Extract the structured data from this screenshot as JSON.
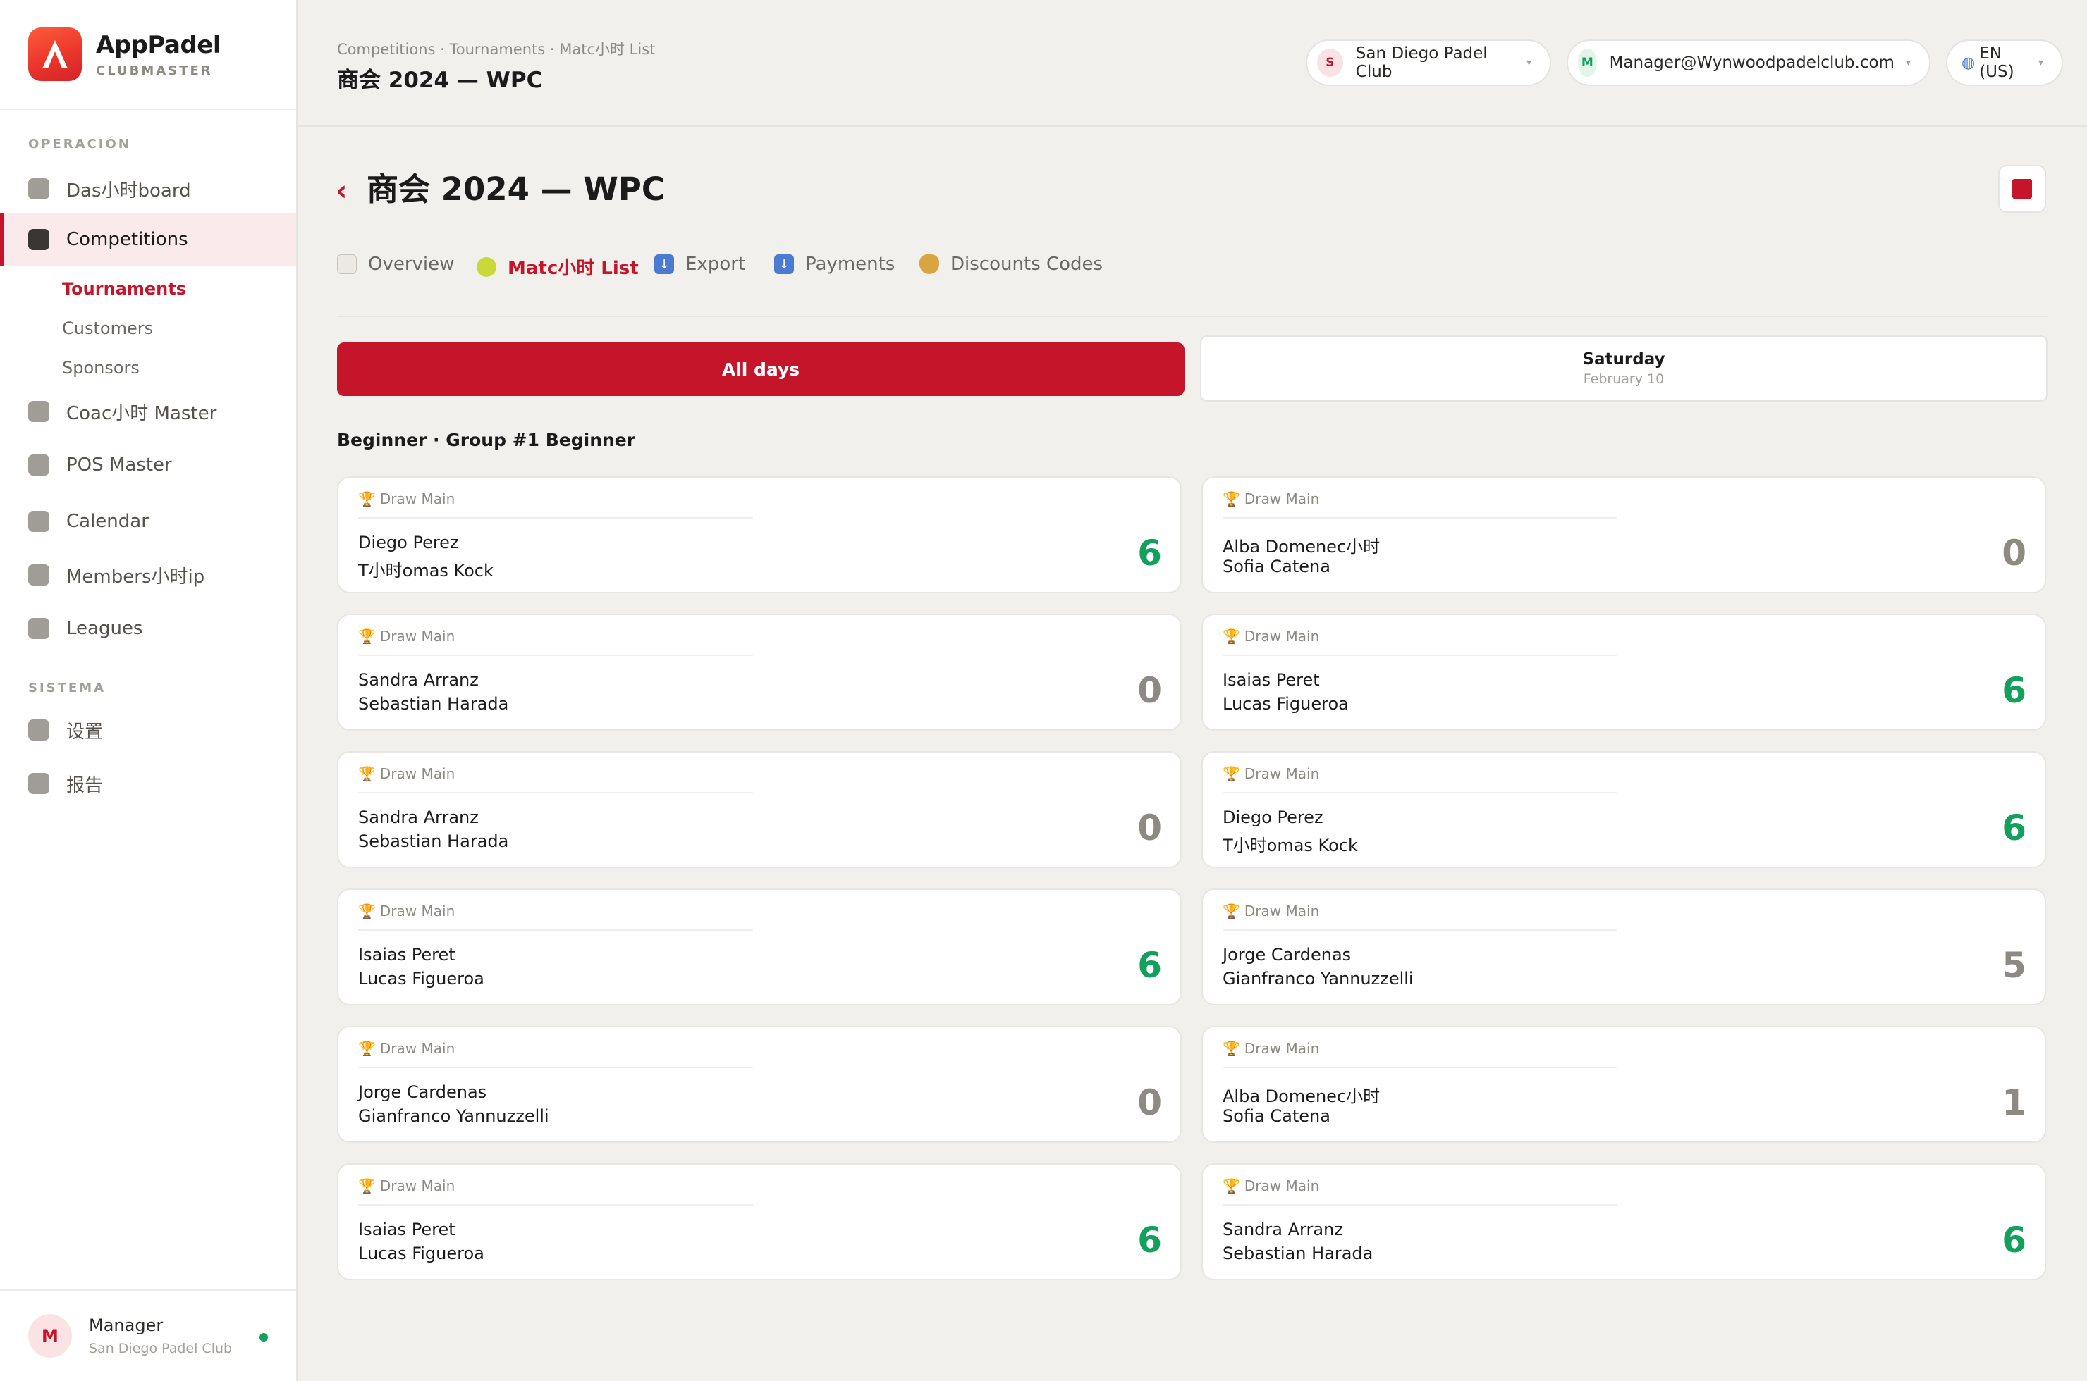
{
  "brand": {
    "name": "AppPadel",
    "sub": "CLUBMASTER"
  },
  "sidebar": {
    "section_operacion": "OPERACIÓN",
    "section_sistema": "SISTEMA",
    "items": [
      {
        "label": "Das小时board"
      },
      {
        "label": "Competitions"
      },
      {
        "label": "Coac小时 Master"
      },
      {
        "label": "POS Master"
      },
      {
        "label": "Calendar"
      },
      {
        "label": "Members小时ip"
      },
      {
        "label": "Leagues"
      },
      {
        "label": "设置"
      },
      {
        "label": "报告"
      }
    ],
    "subitems": [
      {
        "label": "Tournaments"
      },
      {
        "label": "Customers"
      },
      {
        "label": "Sponsors"
      }
    ]
  },
  "profile": {
    "initial": "M",
    "name": "Manager",
    "club": "San Diego Padel Club"
  },
  "header": {
    "breadcrumb": "Competitions · Tournaments · Matc小时 List",
    "title": "商会 2024 — WPC",
    "club": {
      "initial": "S",
      "label": "San Diego Padel Club"
    },
    "user": {
      "initial": "M",
      "label": "Manager@Wynwoodpadelclub.com"
    },
    "lang": {
      "label": "EN (US)"
    }
  },
  "main": {
    "title": "商会 2024 — WPC",
    "tabs": [
      {
        "label": "Overview",
        "icon": "calendar-icon"
      },
      {
        "label": "Matc小时 List",
        "icon": "tennis-ball-icon"
      },
      {
        "label": "Export",
        "icon": "download-icon"
      },
      {
        "label": "Payments",
        "icon": "download-icon"
      },
      {
        "label": "Discounts Codes",
        "icon": "money-bag-icon"
      }
    ],
    "days": {
      "all": "All days",
      "saturday": {
        "day": "Saturday",
        "date": "February 10"
      }
    },
    "group_title": "Beginner · Group #1 Beginner",
    "draw_label": "Draw Main",
    "matches": [
      {
        "p1": "Diego Perez",
        "p2": "T小时omas Kock",
        "score": "6",
        "win": true
      },
      {
        "p1": "Alba Domenec小时",
        "p2": "Sofia Catena",
        "score": "0",
        "win": false
      },
      {
        "p1": "Sandra Arranz",
        "p2": "Sebastian Harada",
        "score": "0",
        "win": false
      },
      {
        "p1": "Isaias Peret",
        "p2": "Lucas Figueroa",
        "score": "6",
        "win": true
      },
      {
        "p1": "Sandra Arranz",
        "p2": "Sebastian Harada",
        "score": "0",
        "win": false
      },
      {
        "p1": "Diego Perez",
        "p2": "T小时omas Kock",
        "score": "6",
        "win": true
      },
      {
        "p1": "Isaias Peret",
        "p2": "Lucas Figueroa",
        "score": "6",
        "win": true
      },
      {
        "p1": "Jorge Cardenas",
        "p2": "Gianfranco Yannuzzelli",
        "score": "5",
        "win": false
      },
      {
        "p1": "Jorge Cardenas",
        "p2": "Gianfranco Yannuzzelli",
        "score": "0",
        "win": false
      },
      {
        "p1": "Alba Domenec小时",
        "p2": "Sofia Catena",
        "score": "1",
        "win": false
      },
      {
        "p1": "Isaias Peret",
        "p2": "Lucas Figueroa",
        "score": "6",
        "win": true
      },
      {
        "p1": "Sandra Arranz",
        "p2": "Sebastian Harada",
        "score": "6",
        "win": true
      }
    ]
  },
  "colors": {
    "accent": "#c4152b",
    "win": "#12a05c",
    "lose": "#8d8a84"
  }
}
